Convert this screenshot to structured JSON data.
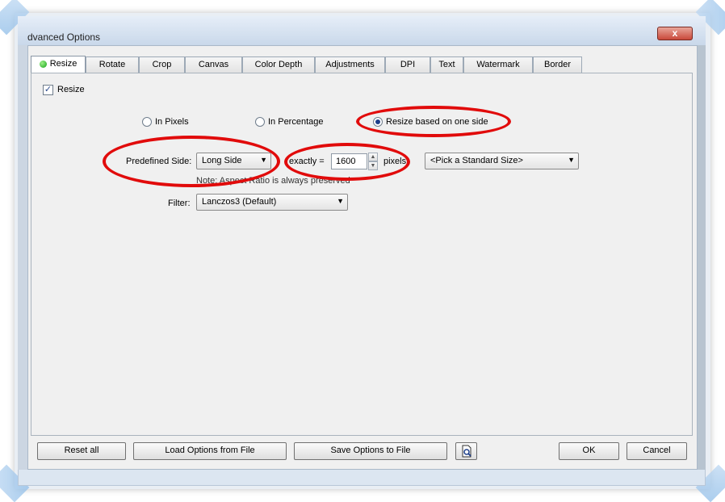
{
  "window": {
    "title": "dvanced Options",
    "close_label": "x"
  },
  "tabs": [
    {
      "label": "Resize",
      "active": true
    },
    {
      "label": "Rotate"
    },
    {
      "label": "Crop"
    },
    {
      "label": "Canvas"
    },
    {
      "label": "Color Depth"
    },
    {
      "label": "Adjustments"
    },
    {
      "label": "DPI"
    },
    {
      "label": "Text"
    },
    {
      "label": "Watermark"
    },
    {
      "label": "Border"
    }
  ],
  "resize": {
    "checkbox_label": "Resize",
    "checked": true,
    "mode_options": {
      "pixels": "In Pixels",
      "percentage": "In Percentage",
      "one_side": "Resize based on one side"
    },
    "selected_mode": "one_side",
    "predefined_side_label": "Predefined Side:",
    "predefined_side_value": "Long Side",
    "exactly_label": "exactly =",
    "exactly_value": "1600",
    "pixels_unit": "pixels",
    "standard_size_value": "<Pick a Standard Size>",
    "note": "Note: Aspect Ratio is always preserved",
    "filter_label": "Filter:",
    "filter_value": "Lanczos3 (Default)"
  },
  "buttons": {
    "reset_all": "Reset all",
    "load_options": "Load Options from File",
    "save_options": "Save Options to File",
    "ok": "OK",
    "cancel": "Cancel"
  },
  "annotation_color": "#e10b0b"
}
